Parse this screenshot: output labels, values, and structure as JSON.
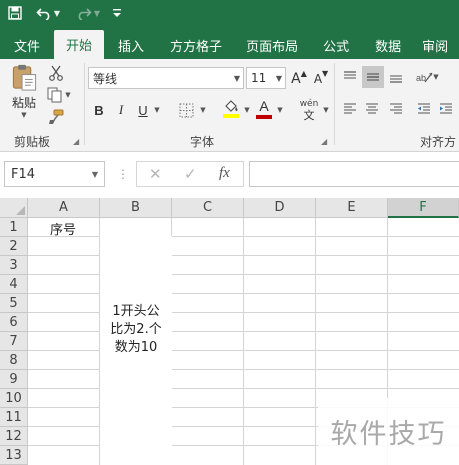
{
  "quick_access": {
    "save_icon": "save-icon",
    "undo_icon": "undo-icon",
    "redo_icon": "redo-icon",
    "customize_icon": "customize-qat-icon"
  },
  "tabs": [
    {
      "label": "文件"
    },
    {
      "label": "开始"
    },
    {
      "label": "插入"
    },
    {
      "label": "方方格子"
    },
    {
      "label": "页面布局"
    },
    {
      "label": "公式"
    },
    {
      "label": "数据"
    },
    {
      "label": "审阅"
    }
  ],
  "ribbon": {
    "clipboard": {
      "paste_label": "粘贴",
      "group_label": "剪贴板"
    },
    "font": {
      "font_name": "等线",
      "font_size": "11",
      "bold": "B",
      "italic": "I",
      "underline": "U",
      "increase_size": "A",
      "decrease_size": "A",
      "wen_label": "wén",
      "wen_char": "文",
      "group_label": "字体",
      "fill_color": "#ffff00",
      "font_color": "#c00000"
    },
    "alignment": {
      "group_label": "对齐方"
    }
  },
  "formula_bar": {
    "name_box": "F14",
    "fx": "fx",
    "cancel": "✕",
    "enter": "✓",
    "dots": "⋮",
    "formula": ""
  },
  "grid": {
    "columns": [
      "A",
      "B",
      "C",
      "D",
      "E",
      "F"
    ],
    "selected_column": "F",
    "rows": [
      "1",
      "2",
      "3",
      "4",
      "5",
      "6",
      "7",
      "8",
      "9",
      "10",
      "11",
      "12",
      "13"
    ],
    "cells": {
      "A1": "序号",
      "B_merged_line1": "1开头公",
      "B_merged_line2": "比为2.个",
      "B_merged_line3": "数为10"
    }
  },
  "watermark": "软件技巧",
  "colors": {
    "accent": "#217346",
    "ribbon_bg": "#f3f3f3",
    "header_bg": "#e6e6e6"
  }
}
